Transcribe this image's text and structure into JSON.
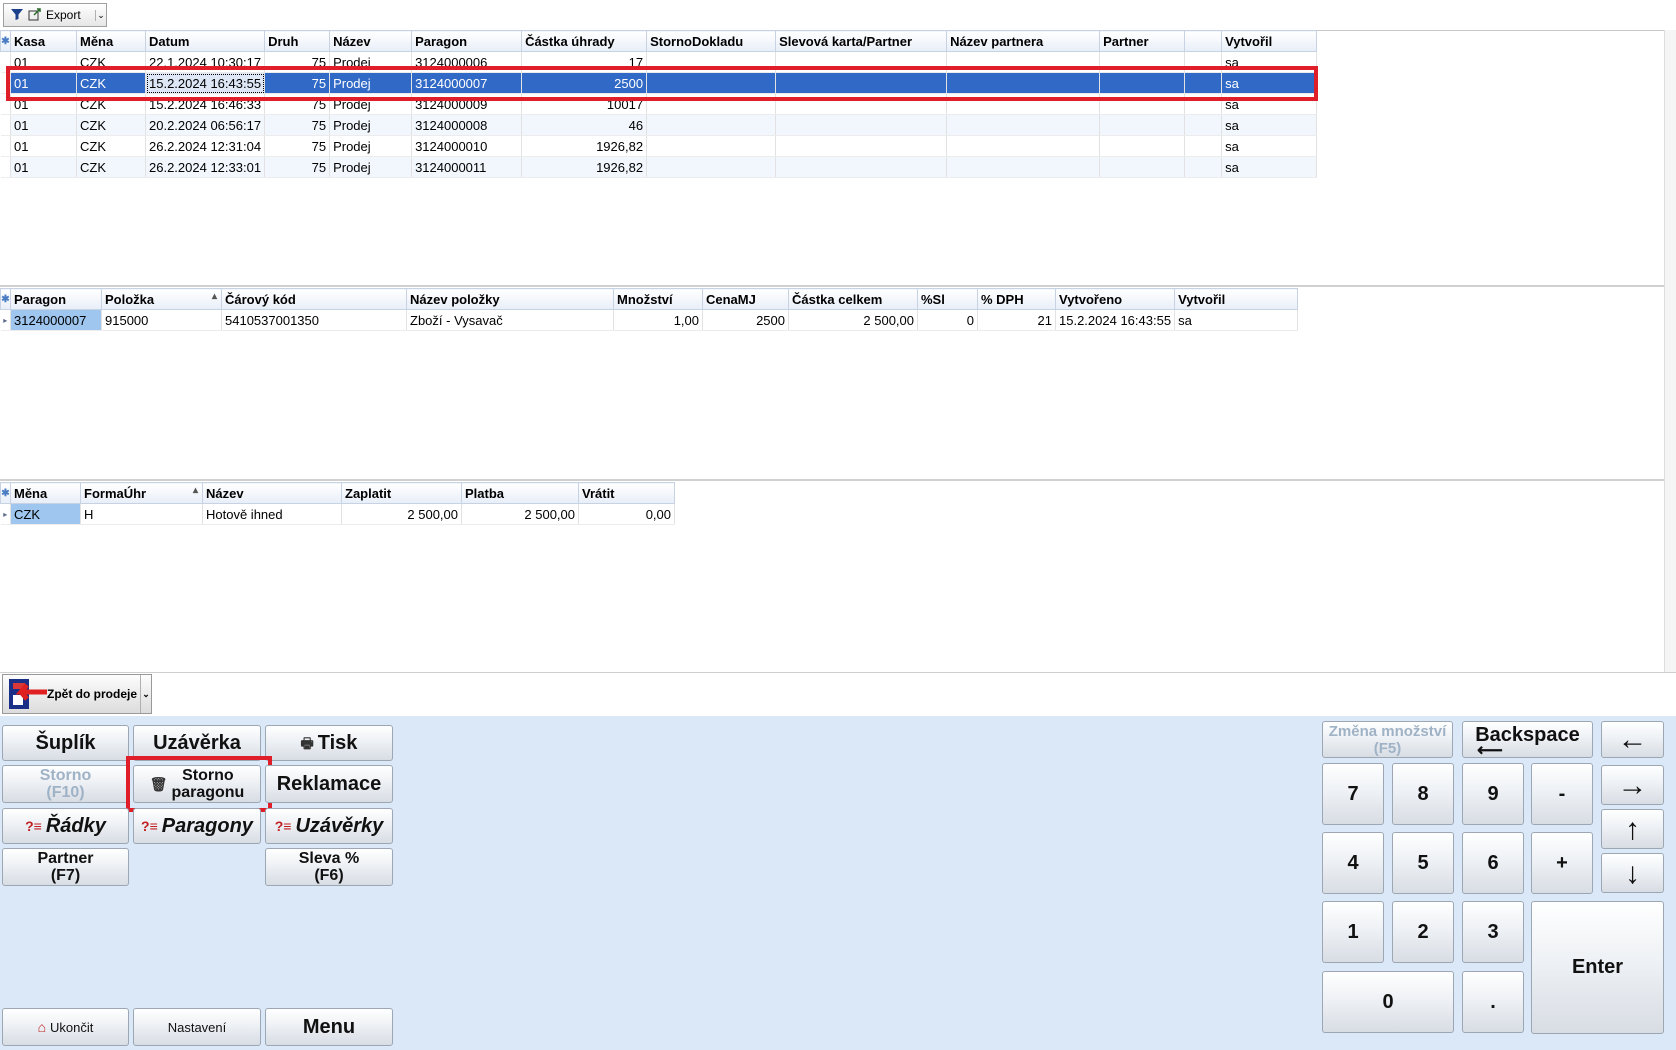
{
  "toolbar": {
    "export_label": "Export"
  },
  "receipts": {
    "columns": [
      "Kasa",
      "Měna",
      "Datum",
      "Druh",
      "Název",
      "Paragon",
      "Částka úhrady",
      "StornoDokladu",
      "Slevová karta/Partner",
      "Název partnera",
      "Partner",
      "",
      "Vytvořil"
    ],
    "rows": [
      [
        "01",
        "CZK",
        "22.1.2024 10:30:17",
        "75",
        "Prodej",
        "3124000006",
        "17",
        "",
        "",
        "",
        "",
        "",
        "sa"
      ],
      [
        "01",
        "CZK",
        "15.2.2024 16:43:55",
        "75",
        "Prodej",
        "3124000007",
        "2500",
        "",
        "",
        "",
        "",
        "",
        "sa"
      ],
      [
        "01",
        "CZK",
        "15.2.2024 16:46:33",
        "75",
        "Prodej",
        "3124000009",
        "10017",
        "",
        "",
        "",
        "",
        "",
        "sa"
      ],
      [
        "01",
        "CZK",
        "20.2.2024 06:56:17",
        "75",
        "Prodej",
        "3124000008",
        "46",
        "",
        "",
        "",
        "",
        "",
        "sa"
      ],
      [
        "01",
        "CZK",
        "26.2.2024 12:31:04",
        "75",
        "Prodej",
        "3124000010",
        "1926,82",
        "",
        "",
        "",
        "",
        "",
        "sa"
      ],
      [
        "01",
        "CZK",
        "26.2.2024 12:33:01",
        "75",
        "Prodej",
        "3124000011",
        "1926,82",
        "",
        "",
        "",
        "",
        "",
        "sa"
      ]
    ]
  },
  "items": {
    "columns": [
      "Paragon",
      "Položka",
      "Čárový kód",
      "Název položky",
      "Množství",
      "CenaMJ",
      "Částka celkem",
      "%Sl",
      "% DPH",
      "Vytvořeno",
      "Vytvořil"
    ],
    "rows": [
      [
        "3124000007",
        "915000",
        "5410537001350",
        "Zboží - Vysavač",
        "1,00",
        "2500",
        "2 500,00",
        "0",
        "21",
        "15.2.2024 16:43:55",
        "sa"
      ]
    ]
  },
  "payments": {
    "columns": [
      "Měna",
      "FormaÚhr",
      "Název",
      "Zaplatit",
      "Platba",
      "Vrátit"
    ],
    "rows": [
      [
        "CZK",
        "H",
        "Hotově ihned",
        "2 500,00",
        "2 500,00",
        "0,00"
      ]
    ]
  },
  "back_button": {
    "label": "Zpět do prodeje"
  },
  "buttons": {
    "suplik": "Šuplík",
    "uzaverka": "Uzávěrka",
    "tisk": "Tisk",
    "storno_f10_1": "Storno",
    "storno_f10_2": "(F10)",
    "storno_paragonu_1": "Storno",
    "storno_paragonu_2": "paragonu",
    "reklamace": "Reklamace",
    "radky": "Řádky",
    "paragony": "Paragony",
    "uzaverky": "Uzávěrky",
    "partner_1": "Partner",
    "partner_2": "(F7)",
    "sleva_1": "Sleva %",
    "sleva_2": "(F6)",
    "ukoncit": "Ukončit",
    "nastaveni": "Nastavení",
    "menu": "Menu"
  },
  "keypad": {
    "zmena_1": "Změna množství",
    "zmena_2": "(F5)",
    "backspace": "Backspace",
    "k7": "7",
    "k8": "8",
    "k9": "9",
    "minus": "-",
    "k4": "4",
    "k5": "5",
    "k6": "6",
    "plus": "+",
    "k1": "1",
    "k2": "2",
    "k3": "3",
    "k0": "0",
    "dot": ".",
    "enter": "Enter"
  },
  "colors": {
    "selection": "#3169c6",
    "highlight": "#e01e2a",
    "panel": "#dbe8f7"
  }
}
